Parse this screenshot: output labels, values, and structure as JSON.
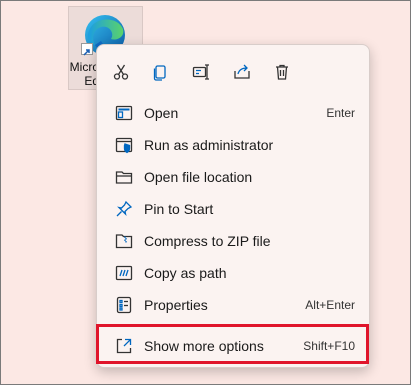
{
  "desktop": {
    "icon_name": "edge-icon",
    "label_lines": [
      "Micro",
      "Ed"
    ]
  },
  "toolbar": [
    {
      "name": "cut-icon"
    },
    {
      "name": "copy-icon"
    },
    {
      "name": "rename-icon"
    },
    {
      "name": "share-icon"
    },
    {
      "name": "delete-icon"
    }
  ],
  "menu": {
    "items": [
      {
        "label": "Open",
        "shortcut": "Enter",
        "icon": "open-icon"
      },
      {
        "label": "Run as administrator",
        "shortcut": "",
        "icon": "shield-icon"
      },
      {
        "label": "Open file location",
        "shortcut": "",
        "icon": "folder-icon"
      },
      {
        "label": "Pin to Start",
        "shortcut": "",
        "icon": "pin-icon"
      },
      {
        "label": "Compress to ZIP file",
        "shortcut": "",
        "icon": "zip-folder-icon"
      },
      {
        "label": "Copy as path",
        "shortcut": "",
        "icon": "copy-path-icon"
      },
      {
        "label": "Properties",
        "shortcut": "Alt+Enter",
        "icon": "properties-icon"
      }
    ],
    "more": {
      "label": "Show more options",
      "shortcut": "Shift+F10",
      "icon": "show-more-icon"
    }
  },
  "colors": {
    "background": "#fce8e4",
    "menu": "#fbf3f1",
    "accent": "#0067c0",
    "highlight": "#e0152b"
  }
}
